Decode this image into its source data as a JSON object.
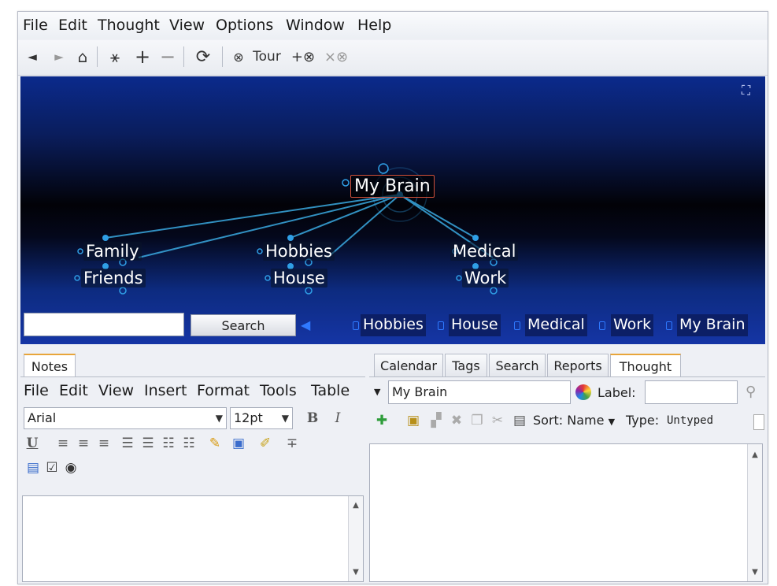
{
  "menubar": {
    "items": [
      "File",
      "Edit",
      "Thought",
      "View",
      "Options",
      "Window",
      "Help"
    ]
  },
  "toolbar": {
    "back_icon": "◄",
    "forward_icon": "►",
    "home_icon": "⌂",
    "layout_icon": "⚹",
    "zoom_in_icon": "+",
    "zoom_out_icon": "−",
    "refresh_icon": "⟳",
    "tour_label": "Tour",
    "tour_add_icon": "+⊗",
    "tour_remove_icon": "×⊗"
  },
  "brain": {
    "active_thought": "My Brain",
    "children": [
      "Family",
      "Friends",
      "Hobbies",
      "House",
      "Medical",
      "Work"
    ],
    "search_button": "Search",
    "search_value": "",
    "history": [
      "Hobbies",
      "House",
      "Medical",
      "Work",
      "My Brain"
    ],
    "fullscreen_icon": "⛶"
  },
  "notes": {
    "tab": "Notes",
    "menu": [
      "File",
      "Edit",
      "View",
      "Insert",
      "Format",
      "Tools",
      "Table"
    ],
    "font": "Arial",
    "size": "12pt",
    "bold": "B",
    "italic": "I",
    "underline": "U"
  },
  "thought_panel": {
    "tabs": [
      "Calendar",
      "Tags",
      "Search",
      "Reports",
      "Thought"
    ],
    "selected_tab": "Thought",
    "name_value": "My Brain",
    "label_caption": "Label:",
    "label_value": "",
    "sort_label": "Sort: Name",
    "type_caption": "Type:",
    "type_value": "Untyped"
  },
  "colors": {
    "accent_tab": "#e8a53a",
    "brain_bg": "#020207",
    "node_line": "#3aa9e0"
  }
}
